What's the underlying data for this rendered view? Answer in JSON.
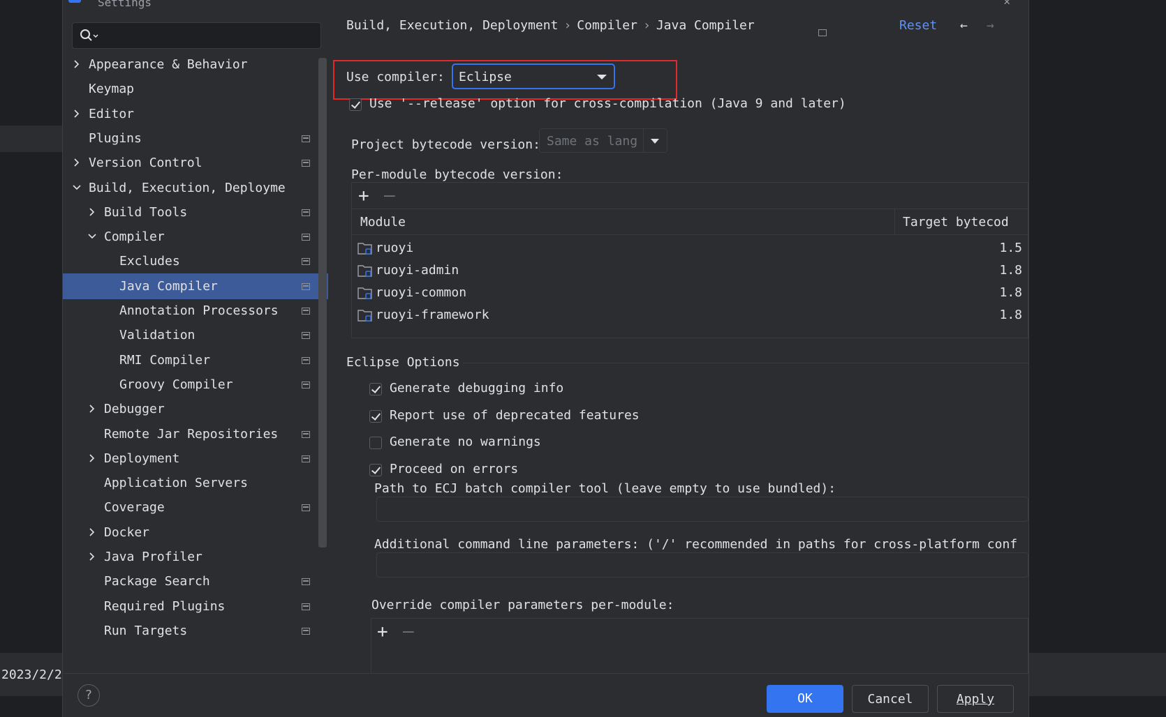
{
  "background": {
    "date_text": "2023/2/2"
  },
  "dialog": {
    "title": "Settings",
    "search": {
      "placeholder": "",
      "value": ""
    },
    "sidebar": {
      "items": [
        {
          "label": "Appearance & Behavior",
          "chevron": "right",
          "pinned": false,
          "selected": false
        },
        {
          "label": "Keymap",
          "chevron": "none",
          "pinned": false,
          "selected": false
        },
        {
          "label": "Editor",
          "chevron": "right",
          "pinned": false,
          "selected": false
        },
        {
          "label": "Plugins",
          "chevron": "none",
          "pinned": true,
          "selected": false
        },
        {
          "label": "Version Control",
          "chevron": "right",
          "pinned": true,
          "selected": false
        },
        {
          "label": "Build, Execution, Deployme",
          "chevron": "down",
          "pinned": false,
          "selected": false
        },
        {
          "label": "Build Tools",
          "chevron": "right",
          "pinned": true,
          "selected": false
        },
        {
          "label": "Compiler",
          "chevron": "down",
          "pinned": true,
          "selected": false
        },
        {
          "label": "Excludes",
          "chevron": "none",
          "pinned": true,
          "selected": false
        },
        {
          "label": "Java Compiler",
          "chevron": "none",
          "pinned": true,
          "selected": true
        },
        {
          "label": "Annotation Processors",
          "chevron": "none",
          "pinned": true,
          "selected": false
        },
        {
          "label": "Validation",
          "chevron": "none",
          "pinned": true,
          "selected": false
        },
        {
          "label": "RMI Compiler",
          "chevron": "none",
          "pinned": true,
          "selected": false
        },
        {
          "label": "Groovy Compiler",
          "chevron": "none",
          "pinned": true,
          "selected": false
        },
        {
          "label": "Debugger",
          "chevron": "right",
          "pinned": false,
          "selected": false
        },
        {
          "label": "Remote Jar Repositories",
          "chevron": "none",
          "pinned": true,
          "selected": false
        },
        {
          "label": "Deployment",
          "chevron": "right",
          "pinned": true,
          "selected": false
        },
        {
          "label": "Application Servers",
          "chevron": "none",
          "pinned": false,
          "selected": false
        },
        {
          "label": "Coverage",
          "chevron": "none",
          "pinned": true,
          "selected": false
        },
        {
          "label": "Docker",
          "chevron": "right",
          "pinned": false,
          "selected": false
        },
        {
          "label": "Java Profiler",
          "chevron": "right",
          "pinned": false,
          "selected": false
        },
        {
          "label": "Package Search",
          "chevron": "none",
          "pinned": true,
          "selected": false
        },
        {
          "label": "Required Plugins",
          "chevron": "none",
          "pinned": true,
          "selected": false
        },
        {
          "label": "Run Targets",
          "chevron": "none",
          "pinned": true,
          "selected": false
        }
      ]
    },
    "breadcrumb": {
      "part1": "Build, Execution, Deployment",
      "sep": "›",
      "part2": "Compiler",
      "part3": "Java Compiler"
    },
    "reset_label": "Reset",
    "use_compiler": {
      "label": "Use compiler:",
      "value": "Eclipse"
    },
    "release_option": {
      "label": "Use '--release' option for cross-compilation (Java 9 and later)",
      "checked": true
    },
    "project_bytecode": {
      "label": "Project bytecode version:",
      "value": "Same as lang"
    },
    "per_module": {
      "label": "Per-module bytecode version:",
      "columns": [
        "Module",
        "Target bytecod"
      ],
      "rows": [
        {
          "module": "ruoyi",
          "version": "1.5"
        },
        {
          "module": "ruoyi-admin",
          "version": "1.8"
        },
        {
          "module": "ruoyi-common",
          "version": "1.8"
        },
        {
          "module": "ruoyi-framework",
          "version": "1.8"
        }
      ]
    },
    "eclipse_options": {
      "title": "Eclipse Options",
      "checkboxes": [
        {
          "label": "Generate debugging info",
          "checked": true
        },
        {
          "label": "Report use of deprecated features",
          "checked": true
        },
        {
          "label": "Generate no warnings",
          "checked": false
        },
        {
          "label": "Proceed on errors",
          "checked": true
        }
      ],
      "ecj_path_label": "Path to ECJ batch compiler tool (leave empty to use bundled):",
      "ecj_path_value": "",
      "additional_params_label": "Additional command line parameters:  ('/' recommended in paths for cross-platform conf",
      "additional_params_value": "",
      "override_label": "Override compiler parameters per-module:"
    },
    "buttons": {
      "ok": "OK",
      "cancel": "Cancel",
      "apply": "Apply"
    },
    "colors": {
      "accent": "#3574f0",
      "highlight_box": "#e5282b",
      "selection": "#3d5a99",
      "link": "#5e93f5"
    }
  }
}
